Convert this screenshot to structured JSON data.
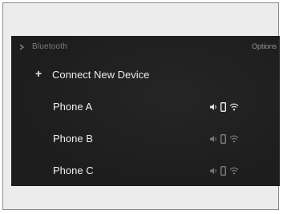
{
  "header": {
    "breadcrumb": "Bluetooth",
    "options_label": "Options"
  },
  "connect": {
    "label": "Connect New Device",
    "icon": "plus-icon"
  },
  "devices": [
    {
      "name": "Phone A",
      "active": true,
      "icons": [
        "audio-icon",
        "phone-icon",
        "wifi-icon"
      ]
    },
    {
      "name": "Phone B",
      "active": false,
      "icons": [
        "audio-icon",
        "phone-icon",
        "wifi-icon"
      ]
    },
    {
      "name": "Phone C",
      "active": false,
      "icons": [
        "audio-icon",
        "phone-icon",
        "wifi-icon"
      ]
    }
  ],
  "colors": {
    "screen_background": "#1d1d1d",
    "text": "#f0f0f0",
    "dim_text": "#7d7d7d"
  }
}
